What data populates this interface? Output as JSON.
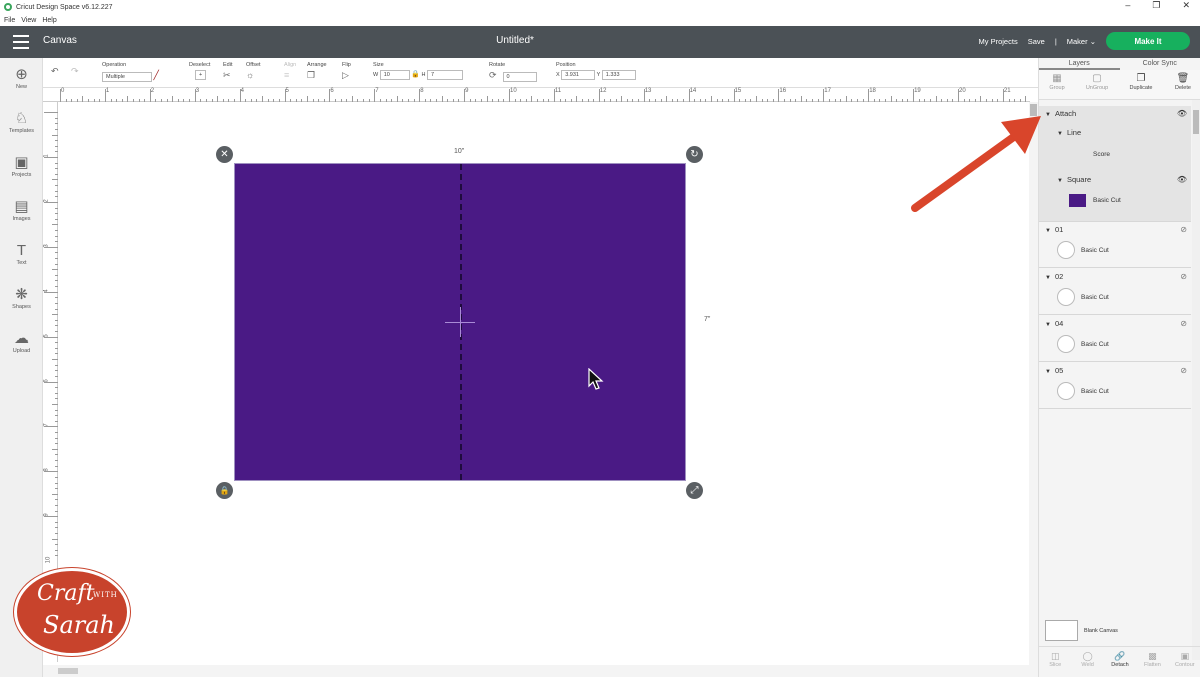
{
  "window": {
    "app_title": "Cricut Design Space  v6.12.227",
    "menu": [
      "File",
      "View",
      "Help"
    ]
  },
  "header": {
    "section": "Canvas",
    "project": "Untitled*",
    "my_projects": "My Projects",
    "save": "Save",
    "separator": "|",
    "machine": "Maker",
    "make_it": "Make It"
  },
  "toolbar": {
    "operation_label": "Operation",
    "operation_value": "Multiple",
    "deselect_label": "Deselect",
    "edit_label": "Edit",
    "offset_label": "Offset",
    "align_label": "Align",
    "arrange_label": "Arrange",
    "flip_label": "Flip",
    "size_label": "Size",
    "w_label": "W",
    "w_value": "10",
    "h_label": "H",
    "h_value": "7",
    "rotate_label": "Rotate",
    "rotate_value": "0",
    "position_label": "Position",
    "x_label": "X",
    "x_value": "3.931",
    "y_label": "Y",
    "y_value": "1.333"
  },
  "sidebar": [
    {
      "label": "New",
      "icon": "plus-icon"
    },
    {
      "label": "Templates",
      "icon": "shirt-icon"
    },
    {
      "label": "Projects",
      "icon": "projects-icon"
    },
    {
      "label": "Images",
      "icon": "image-icon"
    },
    {
      "label": "Text",
      "icon": "text-icon"
    },
    {
      "label": "Shapes",
      "icon": "shapes-icon"
    },
    {
      "label": "Upload",
      "icon": "upload-icon"
    }
  ],
  "ruler": {
    "h_labels": [
      "0",
      "1",
      "2",
      "3",
      "4",
      "5",
      "6",
      "7",
      "8",
      "9",
      "10",
      "11",
      "12",
      "13",
      "14",
      "15",
      "16",
      "17",
      "18",
      "19",
      "20",
      "21"
    ],
    "v_labels": [
      "1",
      "2",
      "3",
      "4",
      "5",
      "6",
      "7",
      "8",
      "9",
      "10"
    ]
  },
  "canvas": {
    "width_dim": "10\"",
    "height_dim": "7\"",
    "shape_color": "#4a1a85"
  },
  "panel": {
    "tabs": [
      "Layers",
      "Color Sync"
    ],
    "actions": [
      "Group",
      "UnGroup",
      "Duplicate",
      "Delete"
    ],
    "layers": {
      "attach": "Attach",
      "line": "Line",
      "score": "Score",
      "square": "Square",
      "square_op": "Basic Cut",
      "groups": [
        {
          "name": "01",
          "op": "Basic Cut"
        },
        {
          "name": "02",
          "op": "Basic Cut"
        },
        {
          "name": "04",
          "op": "Basic Cut"
        },
        {
          "name": "05",
          "op": "Basic Cut"
        }
      ]
    },
    "blank_canvas": "Blank Canvas",
    "bottom": [
      "Slice",
      "Weld",
      "Detach",
      "Flatten",
      "Contour"
    ]
  },
  "logo": {
    "craft": "Craft",
    "with": "WITH",
    "sarah": "Sarah"
  },
  "colors": {
    "accent_green": "#17b05e",
    "header": "#4b5156",
    "arrow": "#d9452b"
  }
}
